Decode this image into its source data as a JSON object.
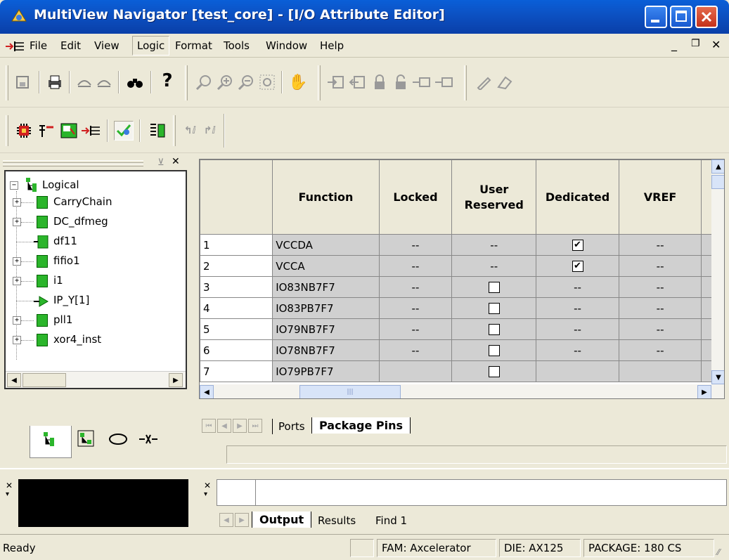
{
  "window": {
    "title": "MultiView Navigator [test_core] - [I/O Attribute Editor]"
  },
  "menu": {
    "items": [
      "File",
      "Edit",
      "View",
      "Logic",
      "Format",
      "Tools",
      "Window",
      "Help"
    ]
  },
  "tree": {
    "root": "Logical",
    "nodes": [
      {
        "label": "CarryChain",
        "expandable": true
      },
      {
        "label": "DC_dfmeg",
        "expandable": true
      },
      {
        "label": "df11",
        "expandable": false
      },
      {
        "label": "fifio1",
        "expandable": true
      },
      {
        "label": "i1",
        "expandable": true
      },
      {
        "label": "IP_Y[1]",
        "expandable": false
      },
      {
        "label": "pll1",
        "expandable": true
      },
      {
        "label": "xor4_inst",
        "expandable": true
      }
    ]
  },
  "table": {
    "headers": [
      "Function",
      "Locked",
      "User Reserved",
      "Dedicated",
      "VREF"
    ],
    "rows": [
      {
        "num": "1",
        "function": "VCCDA",
        "locked": "--",
        "user_reserved": "--",
        "dedicated": "checked",
        "vref": "--"
      },
      {
        "num": "2",
        "function": "VCCA",
        "locked": "--",
        "user_reserved": "--",
        "dedicated": "checked",
        "vref": "--"
      },
      {
        "num": "3",
        "function": "IO83NB7F7",
        "locked": "--",
        "user_reserved": "unchecked",
        "dedicated": "--",
        "vref": "--"
      },
      {
        "num": "4",
        "function": "IO83PB7F7",
        "locked": "--",
        "user_reserved": "unchecked",
        "dedicated": "--",
        "vref": "--"
      },
      {
        "num": "5",
        "function": "IO79NB7F7",
        "locked": "--",
        "user_reserved": "unchecked",
        "dedicated": "--",
        "vref": "--"
      },
      {
        "num": "6",
        "function": "IO78NB7F7",
        "locked": "--",
        "user_reserved": "unchecked",
        "dedicated": "--",
        "vref": "--"
      },
      {
        "num": "7",
        "function": "IO79PB7F7",
        "locked": "",
        "user_reserved": "unchecked",
        "dedicated": "",
        "vref": ""
      }
    ]
  },
  "sheet_tabs": [
    "Ports",
    "Package Pins"
  ],
  "output_tabs": [
    "Output",
    "Results",
    "Find 1"
  ],
  "status": {
    "ready": "Ready",
    "family": "FAM: Axcelerator",
    "die": "DIE: AX125",
    "package": "PACKAGE: 180 CS"
  },
  "colors": {
    "titlebar": "#0a52c4",
    "chrome": "#ece9d8",
    "cell_grey": "#d0d0d0",
    "node_green": "#2bb52b"
  }
}
